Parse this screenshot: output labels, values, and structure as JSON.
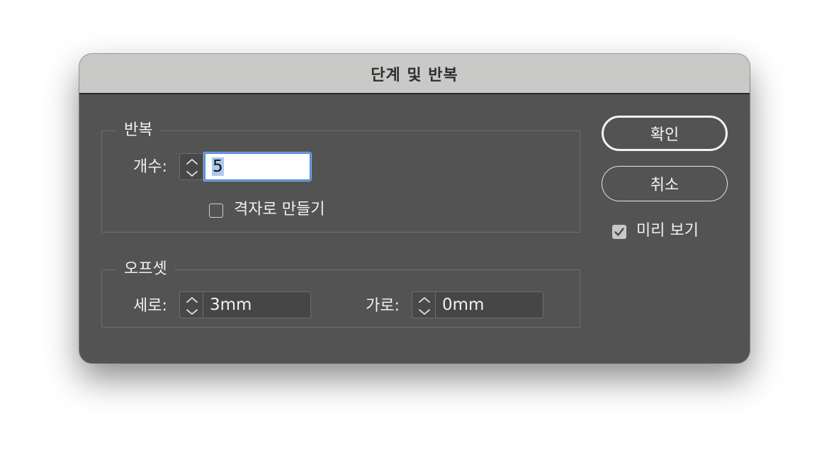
{
  "dialog": {
    "title": "단계 및 반복"
  },
  "repeat": {
    "legend": "반복",
    "count_label": "개수:",
    "count_value": "5",
    "grid_label": "격자로 만들기",
    "grid_checked": false
  },
  "offset": {
    "legend": "오프셋",
    "vertical_label": "세로:",
    "vertical_value": "3mm",
    "horizontal_label": "가로:",
    "horizontal_value": "0mm"
  },
  "actions": {
    "ok_label": "확인",
    "cancel_label": "취소",
    "preview_label": "미리 보기",
    "preview_checked": true
  },
  "icons": {
    "spinner": "up-down-chevron-icon",
    "checkmark": "checkmark-icon"
  },
  "colors": {
    "dialog_bg": "#535353",
    "titlebar_bg": "#c9c9c7",
    "focus_ring": "#4f89d6",
    "selection": "#adc9ef"
  }
}
